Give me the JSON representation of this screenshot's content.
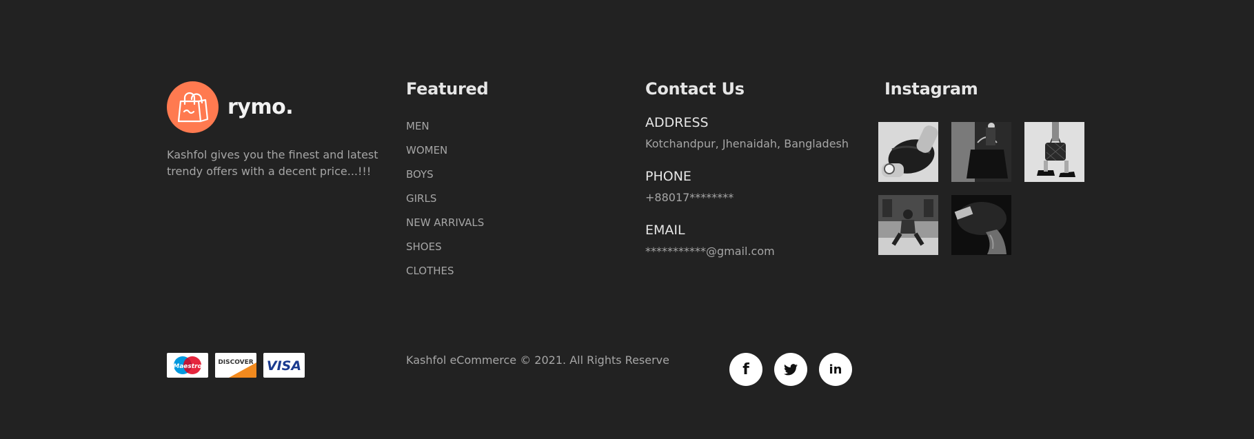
{
  "brand": {
    "name": "rymo.",
    "description": "Kashfol gives you the finest and latest trendy offers with a decent price...!!!",
    "accent_color": "#ff7a50",
    "logo_icon": "shopping-bag-icon"
  },
  "featured": {
    "title": "Featured",
    "items": [
      "MEN",
      "WOMEN",
      "BOYS",
      "GIRLS",
      "NEW ARRIVALS",
      "SHOES",
      "CLOTHES"
    ]
  },
  "contact": {
    "title": "Contact Us",
    "address_label": "ADDRESS",
    "address_value": "Kotchandpur, Jhenaidah, Bangladesh",
    "phone_label": "PHONE",
    "phone_value": "+88017********",
    "email_label": "EMAIL",
    "email_value": "***********@gmail.com"
  },
  "instagram": {
    "title": "Instagram",
    "photos": [
      "instagram-photo-watch-bag",
      "instagram-photo-handbag",
      "instagram-photo-shoes-bag",
      "instagram-photo-street-model",
      "instagram-photo-cap"
    ]
  },
  "payments": {
    "cards": [
      "Maestro",
      "DISCOVER",
      "VISA"
    ]
  },
  "footer": {
    "copyright": "Kashfol eCommerce © 2021. All Rights Reserve"
  },
  "social": {
    "items": [
      {
        "icon": "facebook-icon",
        "glyph": "f"
      },
      {
        "icon": "twitter-icon",
        "glyph": "🐦"
      },
      {
        "icon": "linkedin-icon",
        "glyph": "in"
      }
    ]
  },
  "colors": {
    "background": "#222222",
    "heading": "#e6e6e6",
    "text": "#a6a6a6",
    "accent": "#ff7a50"
  }
}
